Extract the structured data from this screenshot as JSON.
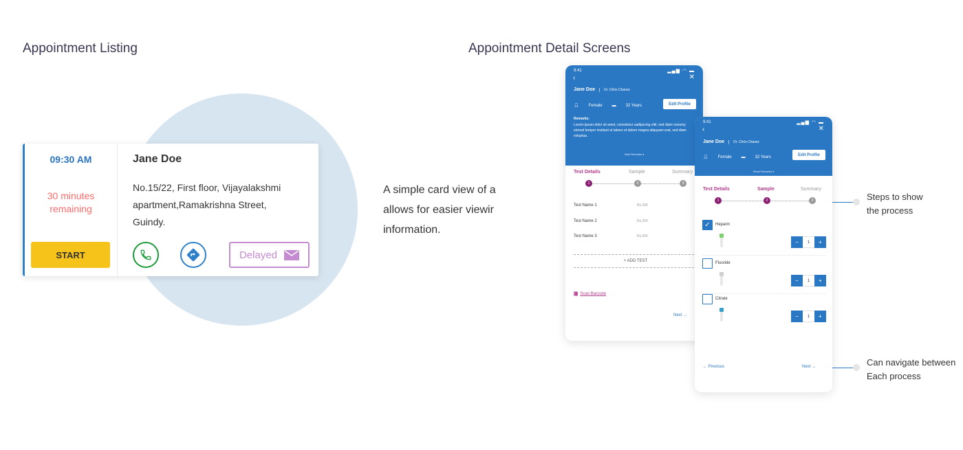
{
  "titles": {
    "listing": "Appointment Listing",
    "detail": "Appointment Detail Screens"
  },
  "listing_card": {
    "time": "09:30 AM",
    "remaining_line1": "30 minutes",
    "remaining_line2": "remaining",
    "start_label": "START",
    "patient_name": "Jane Doe",
    "address_line1": "No.15/22, First floor, Vijayalakshmi",
    "address_line2": "apartment,Ramakrishna Street,",
    "address_line3": "Guindy.",
    "delayed_label": "Delayed",
    "icons": [
      "phone-icon",
      "directions-icon",
      "mail-icon"
    ],
    "colors": {
      "accent": "#2f80c9",
      "start": "#f6c31a",
      "remaining": "#ff6b6b",
      "delayed": "#c58bd0",
      "phone": "#1d9a3a"
    }
  },
  "description": {
    "line1": "A simple card view of a",
    "line2": "allows for easier viewir",
    "line3": "information."
  },
  "detail1": {
    "status_time": "9:41",
    "patient_name": "Jane Doe",
    "doctor": "Dr. Chris Chavez",
    "gender": "Female",
    "age": "32 Years",
    "edit_profile": "Edit Profile",
    "remarks_title": "Remarks:",
    "remarks_text": "Lorem ipsum dolor sit amet, consetetur sadipscing elitr, sed diam nonumy eirmod tempor invidunt ut labore et dolore magna aliquyam erat, sed diam voluptua.",
    "remarks_toggle": "Hide Remarks ▾",
    "steps": [
      {
        "label": "Test Details",
        "num": "1"
      },
      {
        "label": "Sample",
        "num": "2"
      },
      {
        "label": "Summary",
        "num": "3"
      }
    ],
    "tests": [
      {
        "name": "Test Name 1",
        "price": "Rs.200"
      },
      {
        "name": "Test Name 2",
        "price": "Rs.200"
      },
      {
        "name": "Test Name 3",
        "price": "Rs.200"
      }
    ],
    "add_test": "+ ADD TEST",
    "scan_barcode": "Scan Barcode",
    "next": "Next →"
  },
  "detail2": {
    "status_time": "9:41",
    "patient_name": "Jane Doe",
    "doctor": "Dr. Chris Chavez",
    "gender": "Female",
    "age": "32 Years",
    "edit_profile": "Edit Profile",
    "remarks_toggle": "Show Remarks ▾",
    "steps": [
      {
        "label": "Test Details",
        "num": "1"
      },
      {
        "label": "Sample",
        "num": "2"
      },
      {
        "label": "Summary",
        "num": "3"
      }
    ],
    "samples": [
      {
        "name": "Heparin",
        "checked": true,
        "qty": "1",
        "cap_color": "#7fcf70"
      },
      {
        "name": "Fluoride",
        "checked": false,
        "qty": "1",
        "cap_color": "#cfcfcf"
      },
      {
        "name": "Citrate",
        "checked": false,
        "qty": "1",
        "cap_color": "#3aa0c8"
      }
    ],
    "previous": "← Previous",
    "next": "Next →"
  },
  "annotations": {
    "steps_line1": "Steps to show",
    "steps_line2": "the process",
    "nav_line1": "Can navigate between",
    "nav_line2": "Each process"
  }
}
